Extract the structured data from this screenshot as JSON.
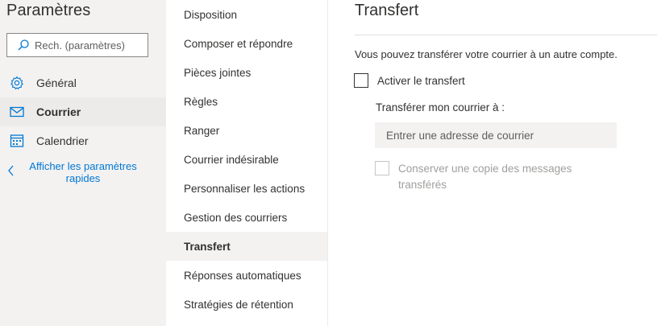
{
  "sidebar": {
    "title": "Paramètres",
    "search_placeholder": "Rech. (paramètres)",
    "items": [
      {
        "label": "Général",
        "icon": "gear-icon",
        "selected": false
      },
      {
        "label": "Courrier",
        "icon": "mail-icon",
        "selected": true
      },
      {
        "label": "Calendrier",
        "icon": "calendar-icon",
        "selected": false
      }
    ],
    "quick_settings_link": "Afficher les paramètres rapides"
  },
  "categories": [
    {
      "label": "Disposition",
      "selected": false
    },
    {
      "label": "Composer et répondre",
      "selected": false
    },
    {
      "label": "Pièces jointes",
      "selected": false
    },
    {
      "label": "Règles",
      "selected": false
    },
    {
      "label": "Ranger",
      "selected": false
    },
    {
      "label": "Courrier indésirable",
      "selected": false
    },
    {
      "label": "Personnaliser les actions",
      "selected": false
    },
    {
      "label": "Gestion des courriers",
      "selected": false
    },
    {
      "label": "Transfert",
      "selected": true
    },
    {
      "label": "Réponses automatiques",
      "selected": false
    },
    {
      "label": "Stratégies de rétention",
      "selected": false
    }
  ],
  "content": {
    "title": "Transfert",
    "description": "Vous pouvez transférer votre courrier à un autre compte.",
    "enable_forwarding": {
      "label": "Activer le transfert",
      "checked": false
    },
    "forward_to_label": "Transférer mon courrier à :",
    "address_field": {
      "placeholder": "Entrer une adresse de courrier",
      "value": ""
    },
    "keep_copy": {
      "label": "Conserver une copie des messages transférés",
      "checked": false,
      "disabled": true
    }
  },
  "colors": {
    "accent": "#0078d4",
    "sidebar_bg": "#f3f2f1",
    "selected_bg": "#edebe9",
    "disabled_text": "#a19f9d"
  }
}
